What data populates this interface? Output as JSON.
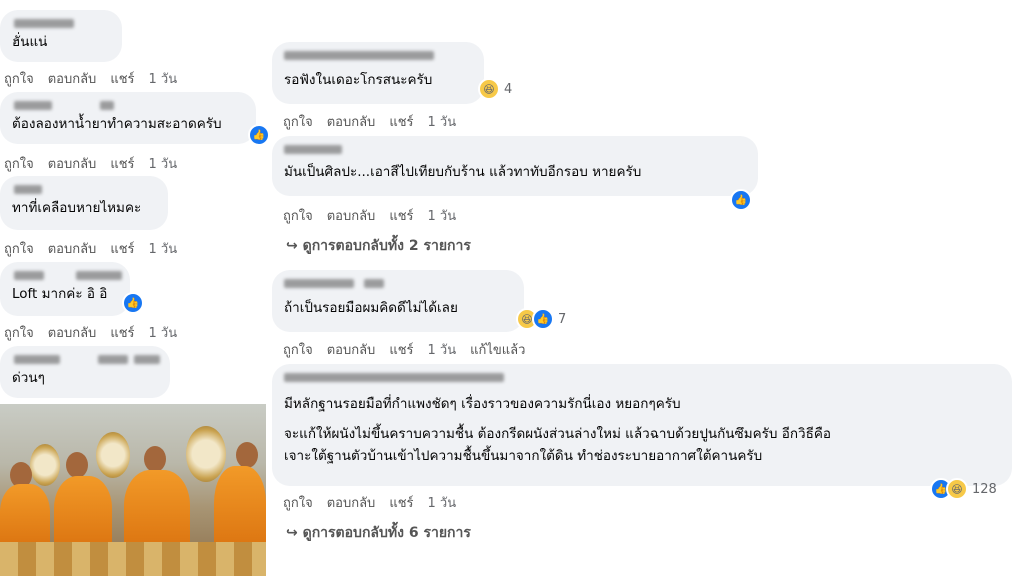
{
  "actions": {
    "like": "ถูกใจ",
    "reply": "ตอบกลับ",
    "share": "แชร์"
  },
  "left_comments": [
    {
      "text": "ฮั่นแน่",
      "time": "1 วัน"
    },
    {
      "text": "ต้องลองหาน้ำยาทำความสะอาดครับ",
      "time": "1 วัน"
    },
    {
      "text": "ทาที่เคลือบหายไหมคะ",
      "time": "1 วัน"
    },
    {
      "text": "Loft มากค่ะ อิ อิ",
      "time": "1 วัน"
    },
    {
      "text": "ด่วนๆ"
    }
  ],
  "right_comments": [
    {
      "text": "รอฟังในเดอะโกรสนะครับ",
      "time": "1 วัน",
      "reaction_count": "4"
    },
    {
      "text": "มันเป็นศิลปะ...เอาสีไปเทียบกับร้าน แล้วทาทับอีกรอบ หายครับ",
      "time": "1 วัน",
      "view_replies": "ดูการตอบกลับทั้ง 2 รายการ"
    },
    {
      "text": "ถ้าเป็นรอยมือผมคิดดีไม่ได้เลย",
      "time": "1 วัน",
      "reaction_count": "7",
      "edited": "แก้ไขแล้ว"
    },
    {
      "text": "มีหลักฐานรอยมือที่กำแพงชัดๆ เรื่องราวของความรักนี่เอง หยอกๆครับ",
      "text2": "จะแก้ให้ผนังไม่ขึ้นคราบความชื้น ต้องกรีดผนังส่วนล่างใหม่ แล้วฉาบด้วยปูนกันซึมครับ อีกวิธีคือ",
      "text3": "เจาะใต้ฐานตัวบ้านเข้าไปความชื้นขึ้นมาจากใต้ดิน ทำช่องระบายอากาศใต้คานครับ",
      "time": "1 วัน",
      "reaction_count": "128",
      "view_replies": "ดูการตอบกลับทั้ง 6 รายการ"
    }
  ],
  "icons": {
    "like": "like-icon",
    "haha": "haha-icon",
    "reply_arrow": "reply-arrow-icon"
  }
}
